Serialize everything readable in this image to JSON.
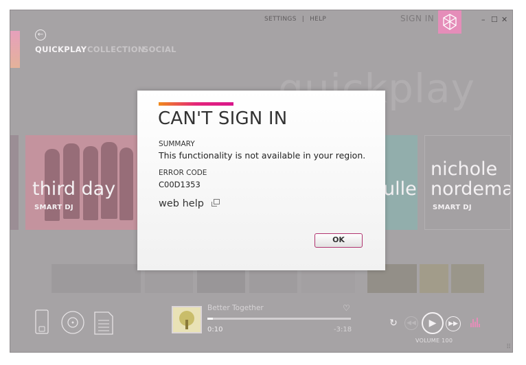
{
  "header": {
    "settings_link": "SETTINGS",
    "separator": "|",
    "help_link": "HELP",
    "sign_in": "SIGN IN",
    "window_controls": {
      "minimize": "–",
      "maximize": "☐",
      "close": "✕"
    }
  },
  "nav": {
    "back_glyph": "←",
    "tabs": [
      {
        "label": "QUICKPLAY",
        "active": true
      },
      {
        "label": "COLLECTION",
        "active": false
      },
      {
        "label": "SOCIAL",
        "active": false
      }
    ]
  },
  "background_heading": "quickplay",
  "tiles": [
    {
      "name": "third day",
      "subtitle": "SMART DJ"
    },
    {
      "name": "ulle",
      "subtitle": ""
    },
    {
      "name_line1": "nichole",
      "name_line2": "nordeman",
      "subtitle": "SMART DJ"
    }
  ],
  "now_playing": {
    "title": "Better Together",
    "elapsed": "0:10",
    "remaining": "-3:18",
    "progress": 0.04
  },
  "playback": {
    "volume_label": "VOLUME 100",
    "icons": [
      "repeat-icon",
      "rewind-icon",
      "play-icon",
      "fast-forward-icon",
      "equalizer-icon"
    ]
  },
  "dialog": {
    "title": "CAN'T SIGN IN",
    "summary_label": "SUMMARY",
    "summary_text": "This functionality is not available in your region.",
    "error_code_label": "ERROR CODE",
    "error_code": "C00D1353",
    "web_help": "web help",
    "ok_label": "OK"
  },
  "colors": {
    "accent_pink": "#e58db9",
    "dialog_bar_start": "#f08a1c",
    "dialog_bar_end": "#d9168c",
    "ok_border": "#b0326e",
    "dimmed_background": "#a6a3a5"
  }
}
